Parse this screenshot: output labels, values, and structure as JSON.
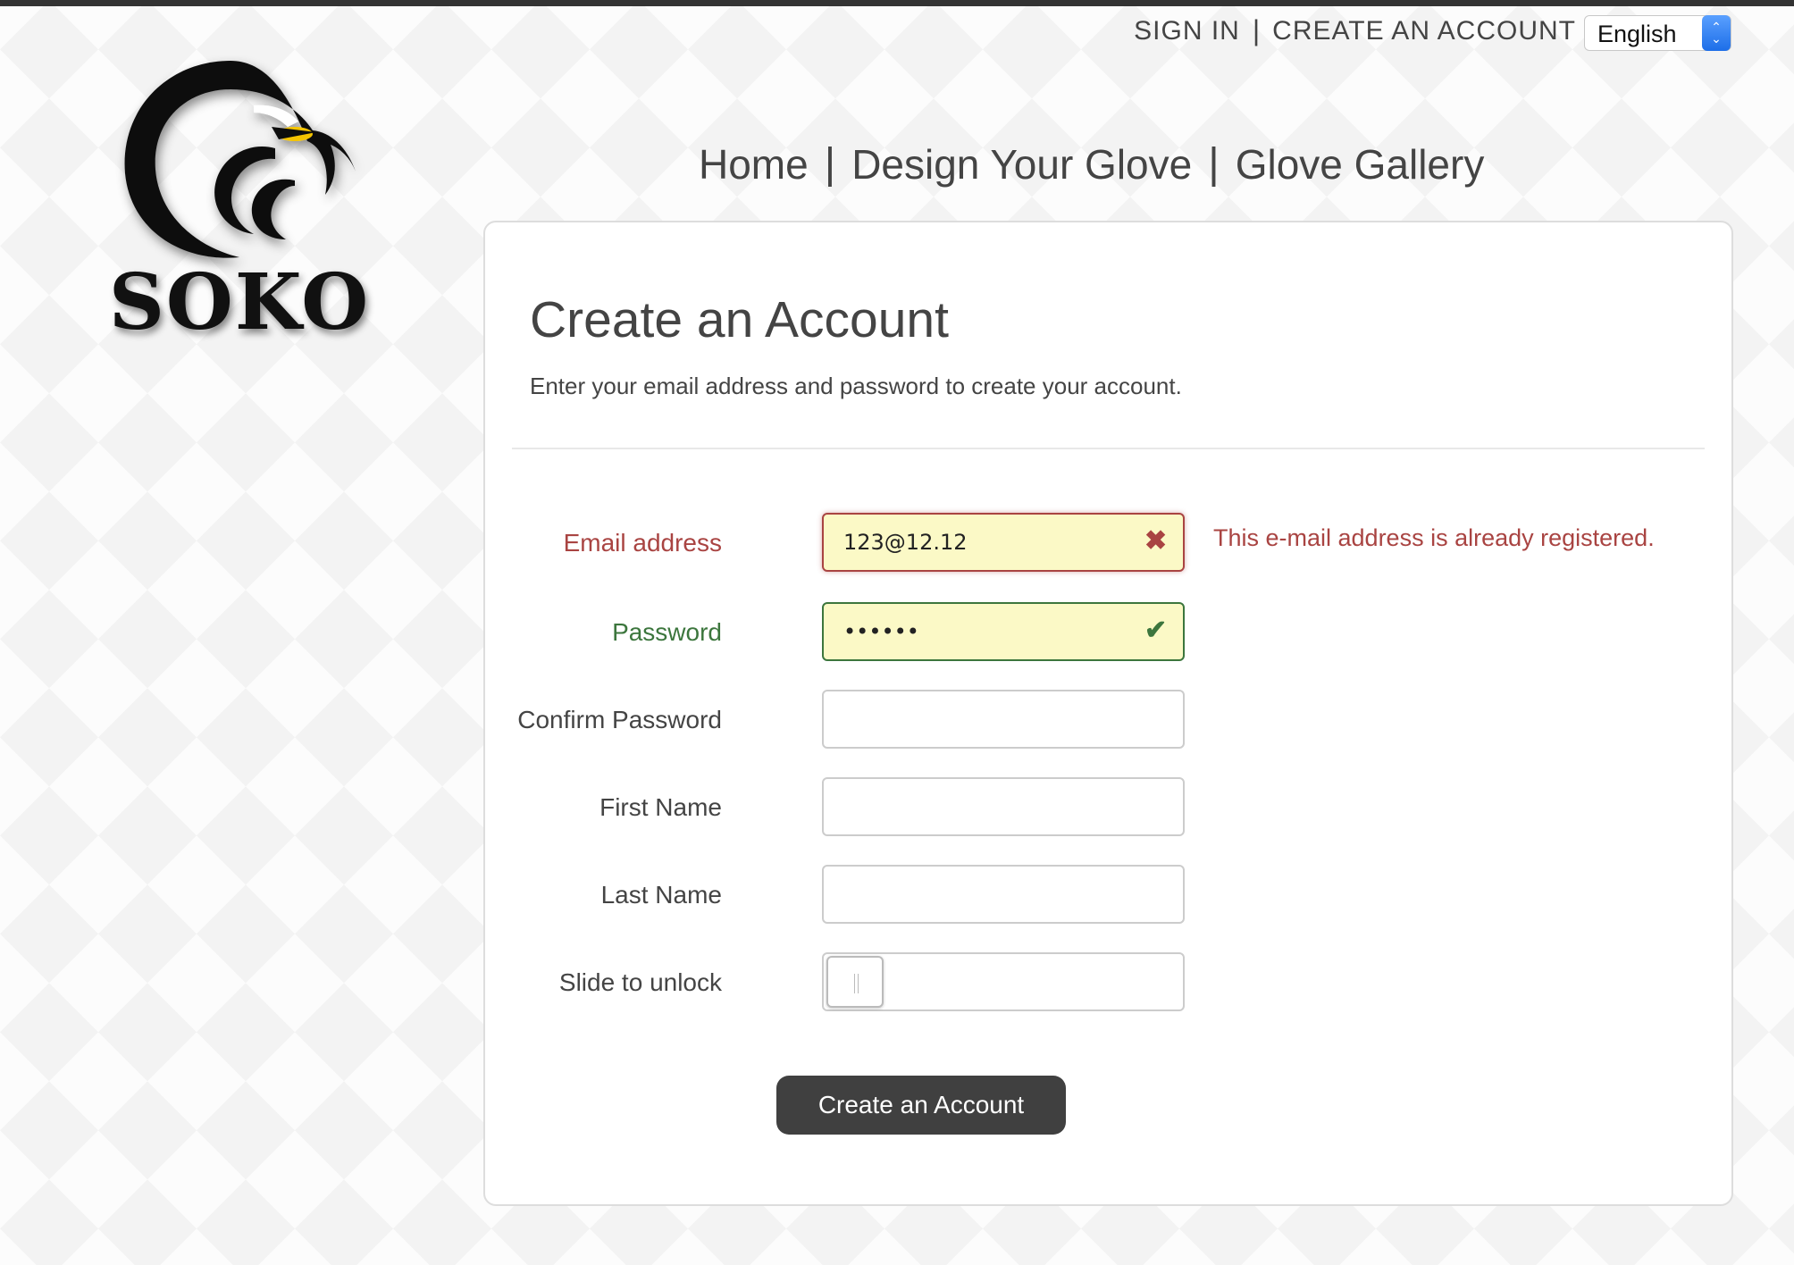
{
  "header": {
    "sign_in": "SIGN IN",
    "separator": "|",
    "create_account": "CREATE AN ACCOUNT",
    "language": {
      "selected": "English"
    }
  },
  "brand": {
    "name": "SOKO",
    "logo_icon": "eagle-head-icon"
  },
  "nav": {
    "items": [
      {
        "label": "Home"
      },
      {
        "label": "Design Your Glove"
      },
      {
        "label": "Glove Gallery"
      }
    ],
    "separator": "|"
  },
  "form": {
    "title": "Create an Account",
    "subtitle": "Enter your email address and password to create your account.",
    "fields": {
      "email": {
        "label": "Email address",
        "value": "123@12.12",
        "status": "error",
        "status_icon": "cross-icon",
        "error_message": "This e-mail address is already registered."
      },
      "password": {
        "label": "Password",
        "value": "••••••",
        "status": "success",
        "status_icon": "check-icon"
      },
      "confirm_password": {
        "label": "Confirm Password",
        "value": ""
      },
      "first_name": {
        "label": "First Name",
        "value": ""
      },
      "last_name": {
        "label": "Last Name",
        "value": ""
      },
      "slider": {
        "label": "Slide to unlock",
        "progress": 0
      }
    },
    "submit_label": "Create an Account"
  },
  "colors": {
    "error": "#a94442",
    "success": "#3c763d",
    "field_highlight": "#fbf9c6",
    "button": "#404040",
    "text": "#444444"
  }
}
